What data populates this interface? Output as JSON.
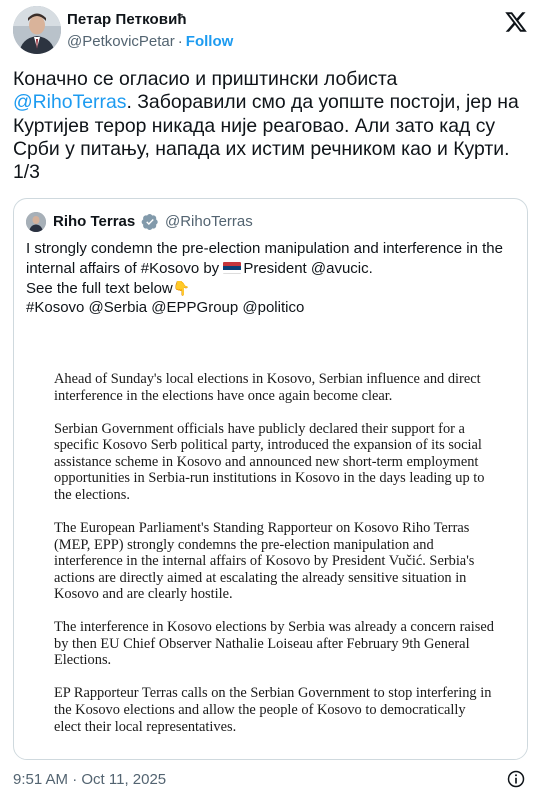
{
  "author": {
    "name": "Петар Петковић",
    "handle": "@PetkovicPetar",
    "separator": "·",
    "follow_label": "Follow"
  },
  "tweet": {
    "line1": "Коначно се огласио и приштински лобиста",
    "mention": "@RihoTerras",
    "text_after_mention": ". Заборавили смо да уопште постоји, јер на Куртијев терор никада није реаговао. Али зато кад су Срби у питању, напада их истим речником као и Курти. 1/3"
  },
  "quoted": {
    "name": "Riho Terras",
    "handle": "@RihoTerras",
    "text_line1_before_flag": "I strongly condemn the pre-election manipulation and interference in the internal affairs of #Kosovo by ",
    "text_line1_after_flag": "President @avucic.",
    "text_line2": "See the full text below",
    "text_line2_emoji": "👇",
    "text_line3": "#Kosovo @Serbia @EPPGroup @politico",
    "flag_colors": [
      "#c6363c",
      "#0c4076",
      "#ffffff"
    ]
  },
  "document": {
    "paragraphs": [
      "Ahead of Sunday's local elections in Kosovo, Serbian influence and direct interference in the elections have once again become clear.",
      "Serbian Government officials have publicly declared their support for a specific Kosovo Serb political party, introduced the expansion of its social assistance scheme in Kosovo and announced new short-term employment opportunities in Serbia-run institutions in Kosovo in the days leading up to the elections.",
      " The European Parliament's Standing Rapporteur on Kosovo Riho Terras (MEP, EPP) strongly condemns the pre-election manipulation and interference in the internal affairs of Kosovo by President Vučić. Serbia's actions are directly aimed at escalating the already sensitive situation in Kosovo and are clearly hostile.",
      "The interference in Kosovo elections by Serbia was already a concern raised by then EU Chief Observer Nathalie Loiseau after February 9th General Elections.",
      "EP Rapporteur Terras calls on the Serbian Government to stop interfering in the Kosovo elections and allow the people of Kosovo to democratically elect their local representatives."
    ]
  },
  "timestamp": "9:51 AM · Oct 11, 2025",
  "icons": {
    "x_logo": "x-logo-icon",
    "verified": "verified-badge-icon",
    "info": "info-icon"
  },
  "colors": {
    "accent": "#1d9bf0",
    "muted": "#536471",
    "border": "#cfd9de",
    "verified_badge": "#829aab"
  }
}
